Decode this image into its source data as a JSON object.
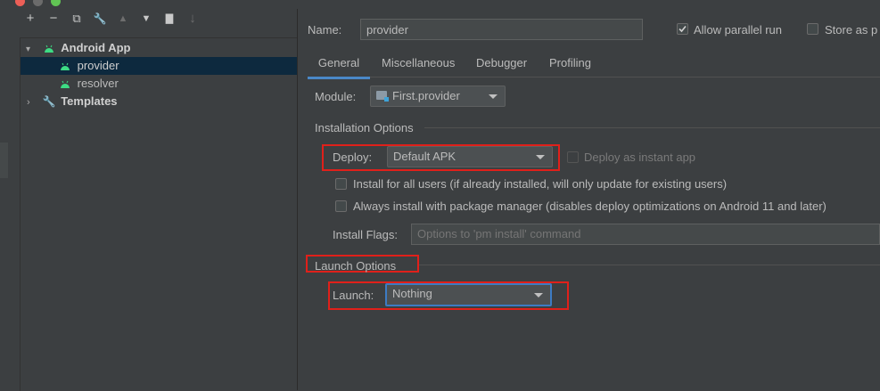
{
  "toolbar": {
    "add": "+",
    "remove": "−",
    "copy": "⧉",
    "edit": "🔧",
    "move_up": "▲",
    "move_down": "▼",
    "folder": "▇",
    "sort": "↓"
  },
  "tree": {
    "items": [
      {
        "label": "Android App",
        "bold": true,
        "expanded": true
      },
      {
        "label": "provider",
        "selected": true
      },
      {
        "label": "resolver"
      },
      {
        "label": "Templates",
        "bold": true,
        "expanded": false
      }
    ]
  },
  "config": {
    "name_label": "Name:",
    "name_value": "provider",
    "allow_parallel_label": "Allow parallel run",
    "allow_parallel_checked": true,
    "store_as_label": "Store as p"
  },
  "tabs": [
    "General",
    "Miscellaneous",
    "Debugger",
    "Profiling"
  ],
  "general": {
    "module_label": "Module:",
    "module_value": "First.provider",
    "installation_header": "Installation Options",
    "deploy_label": "Deploy:",
    "deploy_value": "Default APK",
    "instant_app_label": "Deploy as instant app",
    "install_all_users_label": "Install for all users (if already installed, will only update for existing users)",
    "always_install_label": "Always install with package manager (disables deploy optimizations on Android 11 and later)",
    "install_flags_label": "Install Flags:",
    "install_flags_placeholder": "Options to 'pm install' command",
    "launch_header": "Launch Options",
    "launch_label": "Launch:",
    "launch_value": "Nothing"
  },
  "colors": {
    "background": "#3c3f41",
    "selection": "#0d293e",
    "accent": "#4a88c7",
    "highlight_box": "#e0201a",
    "android_green": "#3ddc84"
  }
}
